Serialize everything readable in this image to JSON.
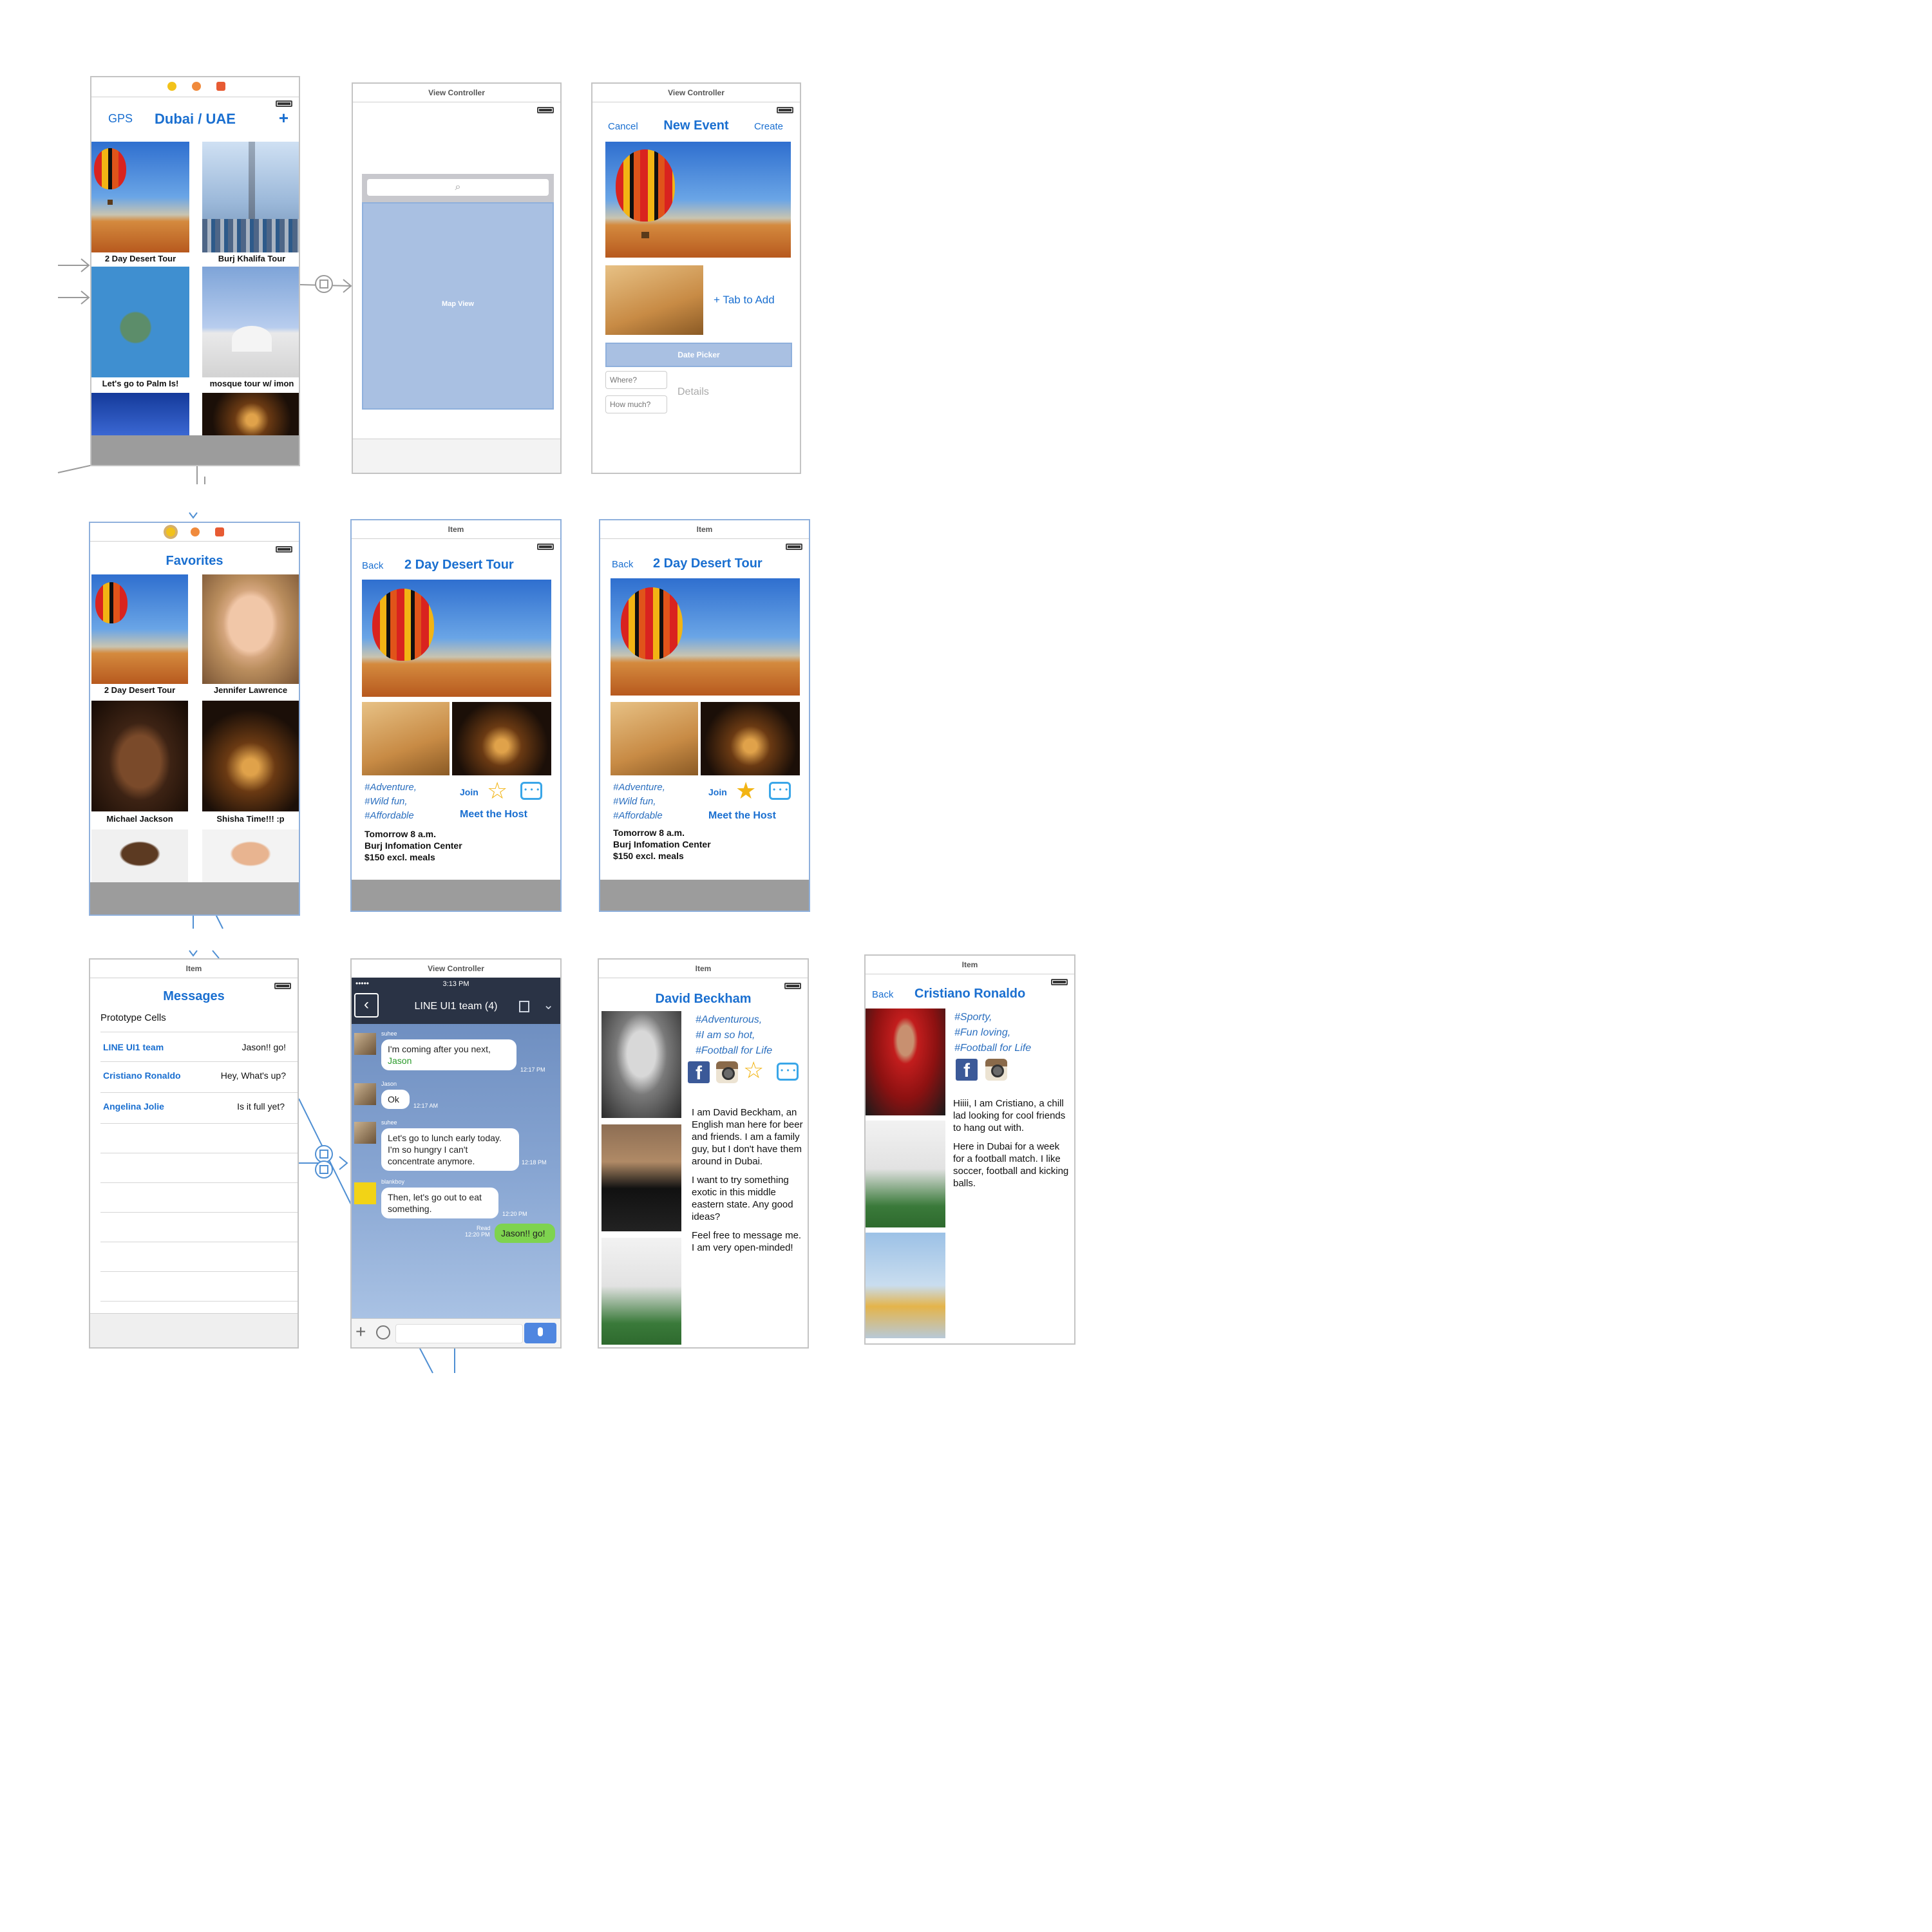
{
  "colors": {
    "accent": "#1a6fd0",
    "bar_gray": "#9c9c9c",
    "map_view": "#a9c0e2",
    "chat_bg": "#7d9ccb",
    "chat_header": "#2a3345",
    "green_bubble": "#7ed34f"
  },
  "screen1": {
    "nav_left": "GPS",
    "title": "Dubai / UAE",
    "nav_right": "+",
    "cells": [
      "2 Day Desert Tour",
      "Burj Khalifa Tour",
      "Let's go to Palm Is!",
      "mosque tour w/ imon"
    ]
  },
  "screen2": {
    "title": "View Controller",
    "map_label": "Map View",
    "search_icon": "search-icon"
  },
  "screen3": {
    "title": "View Controller",
    "nav_left": "Cancel",
    "nav_title": "New Event",
    "nav_right": "Create",
    "tab_to_add": "+ Tab to Add",
    "date_picker": "Date Picker",
    "where_placeholder": "Where?",
    "howmuch_placeholder": "How much?",
    "details": "Details"
  },
  "screen4": {
    "title": "Favorites",
    "cells": [
      "2 Day Desert Tour",
      "Jennifer Lawrence",
      "Michael Jackson",
      "Shisha Time!!! :p"
    ]
  },
  "screen5": {
    "title": "Item",
    "back": "Back",
    "nav_title": "2 Day Desert Tour",
    "tags": [
      "#Adventure,",
      "#Wild fun,",
      "#Affordable"
    ],
    "join": "Join",
    "meet": "Meet the Host",
    "details": [
      "Tomorrow 8 a.m.",
      "Burj Infomation Center",
      "$150 excl. meals"
    ],
    "star_icon": "star-outline-icon"
  },
  "screen6": {
    "title": "Item",
    "back": "Back",
    "nav_title": "2 Day Desert Tour",
    "tags": [
      "#Adventure,",
      "#Wild fun,",
      "#Affordable"
    ],
    "join": "Join",
    "meet": "Meet the Host",
    "details": [
      "Tomorrow 8 a.m.",
      "Burj Infomation Center",
      "$150 excl. meals"
    ],
    "star_icon": "star-filled-icon"
  },
  "screen7": {
    "title": "Item",
    "nav_title": "Messages",
    "section": "Prototype Cells",
    "rows": [
      {
        "name": "LINE UI1 team",
        "preview": "Jason!! go!"
      },
      {
        "name": "Cristiano Ronaldo",
        "preview": "Hey, What's up?"
      },
      {
        "name": "Angelina Jolie",
        "preview": "Is it full yet?"
      }
    ]
  },
  "screen8": {
    "title": "View Controller",
    "carrier": "•••••",
    "time": "3:13 PM",
    "chat_title": "LINE UI1 team (4)",
    "messages": [
      {
        "sender": "suhee",
        "text": "I'm coming after you next,",
        "mention": "Jason",
        "time": "12:17 PM"
      },
      {
        "sender": "Jason",
        "text": "Ok",
        "time": "12:17 AM"
      },
      {
        "sender": "suhee",
        "text": "Let's go to lunch early today. I'm so hungry I can't concentrate anymore.",
        "time": "12:18 PM"
      },
      {
        "sender": "blankboy",
        "text": "Then, let's go out to eat something.",
        "time": "12:20 PM"
      },
      {
        "sender": "",
        "text": "Jason!! go!",
        "read": "Read",
        "time": "12:20 PM"
      }
    ]
  },
  "screen9": {
    "title": "Item",
    "nav_title": "David Beckham",
    "tags": [
      "#Adventurous,",
      "#I am so hot,",
      "#Football for Life"
    ],
    "bio": [
      "I am David Beckham, an English man here for beer and friends. I am a family guy, but I don't have them around in Dubai.",
      "I want to try something exotic in this middle eastern state. Any good ideas?",
      "Feel free to message me. I am very open-minded!"
    ]
  },
  "screen10": {
    "title": "Item",
    "back": "Back",
    "nav_title": "Cristiano Ronaldo",
    "tags": [
      "#Sporty,",
      "#Fun loving,",
      "#Football for Life"
    ],
    "bio": [
      "Hiiii, I am Cristiano, a chill lad looking for cool friends to hang out with.",
      "Here in Dubai for a week for a football match. I like soccer, football and kicking balls."
    ]
  }
}
